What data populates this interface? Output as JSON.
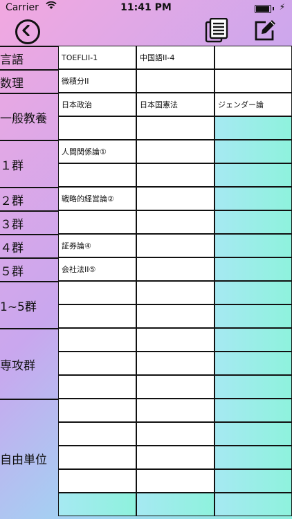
{
  "status": {
    "carrier": "Carrier",
    "time": "11:41 PM"
  },
  "toolbar": {
    "back_icon": "back-chevron-icon",
    "list_icon": "list-icon",
    "edit_icon": "edit-icon"
  },
  "groups": [
    {
      "label": "言語",
      "rows": [
        [
          "TOEFLII-1",
          "中国語II-4",
          ""
        ]
      ]
    },
    {
      "label": "数理",
      "rows": [
        [
          "微積分II",
          "",
          ""
        ]
      ]
    },
    {
      "label": "一般教養",
      "rows": [
        [
          "日本政治",
          "日本国憲法",
          "ジェンダー論"
        ],
        [
          "",
          "",
          ""
        ]
      ]
    },
    {
      "label": "１群",
      "rows": [
        [
          "人間関係論①",
          "",
          ""
        ],
        [
          "",
          "",
          ""
        ]
      ]
    },
    {
      "label": "２群",
      "rows": [
        [
          "戦略的経営論②",
          "",
          ""
        ]
      ]
    },
    {
      "label": "３群",
      "rows": [
        [
          "",
          "",
          ""
        ]
      ]
    },
    {
      "label": "４群",
      "rows": [
        [
          "証券論④",
          "",
          ""
        ]
      ]
    },
    {
      "label": "５群",
      "rows": [
        [
          "会社法II⑤",
          "",
          ""
        ]
      ]
    },
    {
      "label": "1~5群",
      "rows": [
        [
          "",
          "",
          ""
        ],
        [
          "",
          "",
          ""
        ]
      ]
    },
    {
      "label": "専攻群",
      "rows": [
        [
          "",
          "",
          ""
        ],
        [
          "",
          "",
          ""
        ],
        [
          "",
          "",
          ""
        ]
      ]
    },
    {
      "label": "自由単位",
      "rows": [
        [
          "",
          "",
          ""
        ],
        [
          "",
          "",
          ""
        ],
        [
          "",
          "",
          ""
        ],
        [
          "",
          "",
          ""
        ],
        [
          "",
          "",
          ""
        ]
      ]
    }
  ]
}
